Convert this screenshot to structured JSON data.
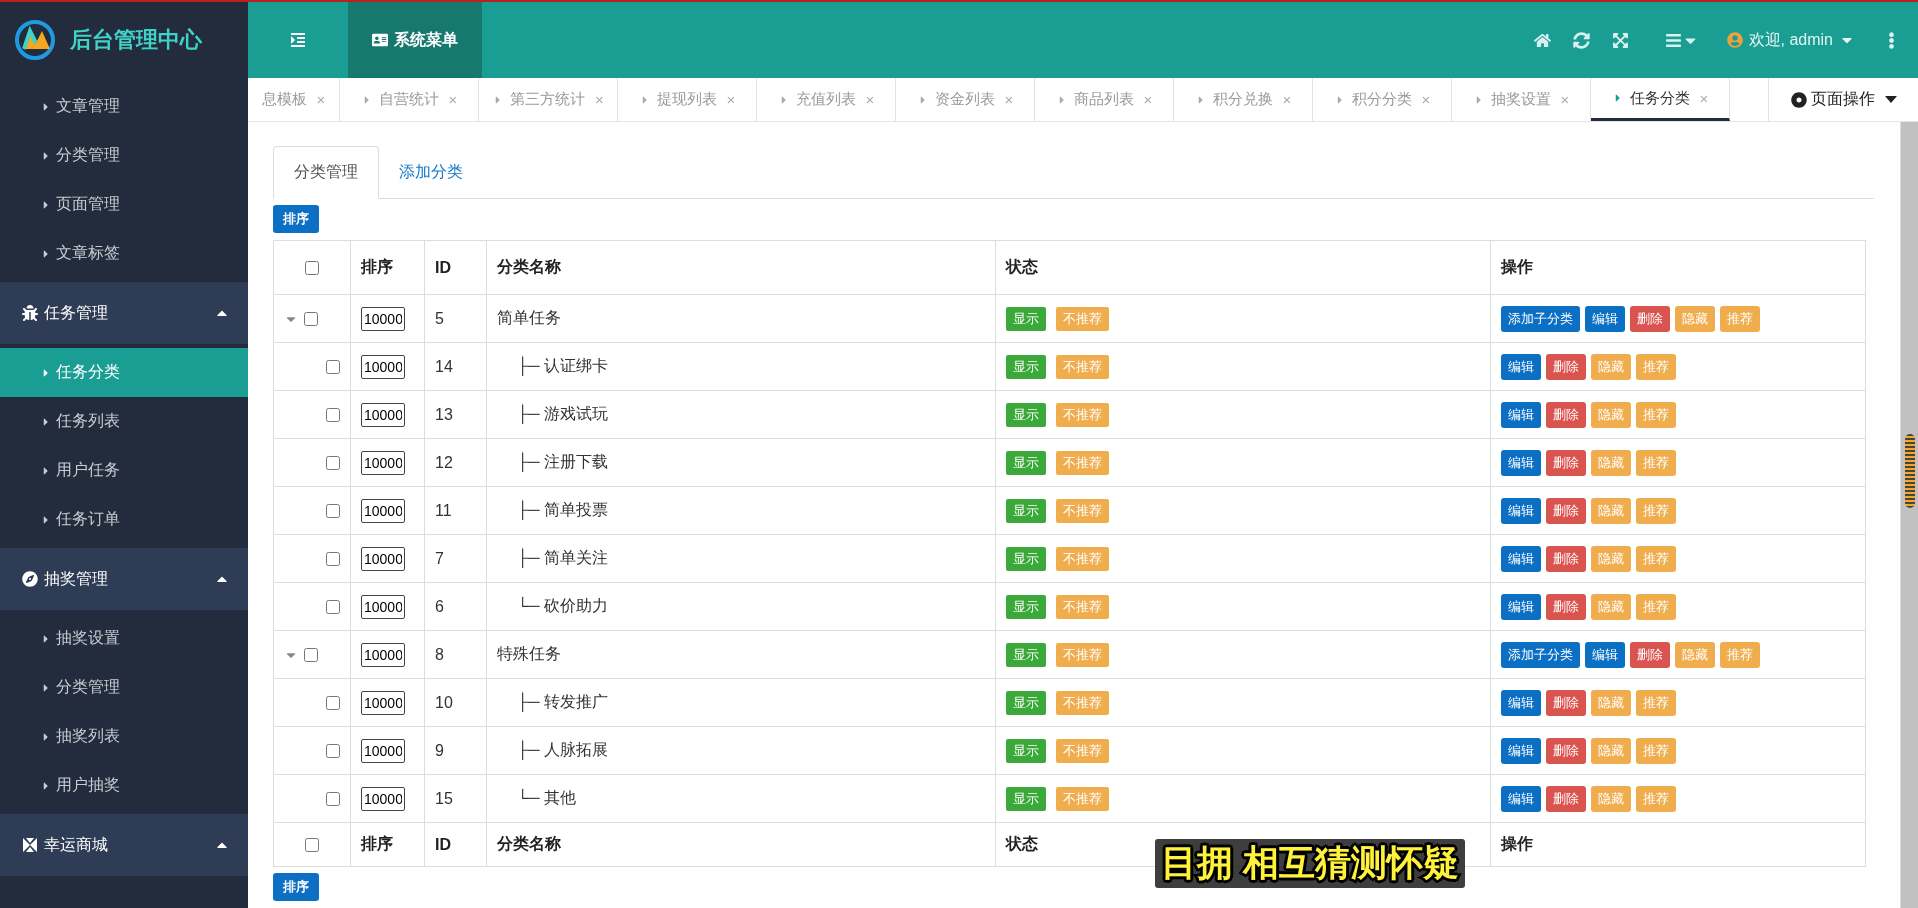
{
  "brand": {
    "title": "后台管理中心"
  },
  "header": {
    "menu_button": "系统菜单",
    "user": "欢迎, admin"
  },
  "sidebar": {
    "items": [
      {
        "kind": "link",
        "label": "文章管理",
        "selected": false
      },
      {
        "kind": "link",
        "label": "分类管理",
        "selected": false
      },
      {
        "kind": "link",
        "label": "页面管理",
        "selected": false
      },
      {
        "kind": "link",
        "label": "文章标签",
        "selected": false
      },
      {
        "kind": "group",
        "label": "任务管理",
        "expanded": true
      },
      {
        "kind": "link",
        "label": "任务分类",
        "selected": true
      },
      {
        "kind": "link",
        "label": "任务列表",
        "selected": false
      },
      {
        "kind": "link",
        "label": "用户任务",
        "selected": false
      },
      {
        "kind": "link",
        "label": "任务订单",
        "selected": false
      },
      {
        "kind": "group",
        "label": "抽奖管理",
        "expanded": true
      },
      {
        "kind": "link",
        "label": "抽奖设置",
        "selected": false
      },
      {
        "kind": "link",
        "label": "分类管理",
        "selected": false
      },
      {
        "kind": "link",
        "label": "抽奖列表",
        "selected": false
      },
      {
        "kind": "link",
        "label": "用户抽奖",
        "selected": false
      },
      {
        "kind": "group",
        "label": "幸运商城",
        "expanded": true
      }
    ]
  },
  "page_tabs": {
    "items": [
      {
        "label": "息模板",
        "close": "×",
        "selected": false
      },
      {
        "label": "自营统计",
        "close": "×",
        "selected": false
      },
      {
        "label": "第三方统计",
        "close": "×",
        "selected": false
      },
      {
        "label": "提现列表",
        "close": "×",
        "selected": false
      },
      {
        "label": "充值列表",
        "close": "×",
        "selected": false
      },
      {
        "label": "资金列表",
        "close": "×",
        "selected": false
      },
      {
        "label": "商品列表",
        "close": "×",
        "selected": false
      },
      {
        "label": "积分兑换",
        "close": "×",
        "selected": false
      },
      {
        "label": "积分分类",
        "close": "×",
        "selected": false
      },
      {
        "label": "抽奖设置",
        "close": "×",
        "selected": false
      },
      {
        "label": "任务分类",
        "close": "×",
        "selected": true
      }
    ],
    "page_actions": "页面操作"
  },
  "content_tabs": [
    {
      "label": "分类管理",
      "selected": true
    },
    {
      "label": "添加分类",
      "selected": false
    }
  ],
  "sort_button": "排序",
  "table": {
    "columns": [
      "排序",
      "ID",
      "分类名称",
      "状态",
      "操作"
    ],
    "rows": [
      {
        "sort": "10000",
        "id": "5",
        "name": "简单任务",
        "checked": false,
        "expanded": true,
        "status": [
          {
            "label": "显示",
            "kind": "success"
          },
          {
            "label": "不推荐",
            "kind": "warning"
          }
        ],
        "actions": [
          {
            "label": "添加子分类",
            "kind": "primary"
          },
          {
            "label": "编辑",
            "kind": "primary"
          },
          {
            "label": "删除",
            "kind": "danger"
          },
          {
            "label": "隐藏",
            "kind": "warning"
          },
          {
            "label": "推荐",
            "kind": "warning"
          }
        ],
        "children": [
          {
            "sort": "10000",
            "id": "14",
            "name": "├─ 认证绑卡",
            "checked": false,
            "status": [
              {
                "label": "显示",
                "kind": "success"
              },
              {
                "label": "不推荐",
                "kind": "warning"
              }
            ],
            "actions": [
              {
                "label": "编辑",
                "kind": "primary"
              },
              {
                "label": "删除",
                "kind": "danger"
              },
              {
                "label": "隐藏",
                "kind": "warning"
              },
              {
                "label": "推荐",
                "kind": "warning"
              }
            ]
          },
          {
            "sort": "10000",
            "id": "13",
            "name": "├─ 游戏试玩",
            "checked": false,
            "status": [
              {
                "label": "显示",
                "kind": "success"
              },
              {
                "label": "不推荐",
                "kind": "warning"
              }
            ],
            "actions": [
              {
                "label": "编辑",
                "kind": "primary"
              },
              {
                "label": "删除",
                "kind": "danger"
              },
              {
                "label": "隐藏",
                "kind": "warning"
              },
              {
                "label": "推荐",
                "kind": "warning"
              }
            ]
          },
          {
            "sort": "10000",
            "id": "12",
            "name": "├─ 注册下载",
            "checked": false,
            "status": [
              {
                "label": "显示",
                "kind": "success"
              },
              {
                "label": "不推荐",
                "kind": "warning"
              }
            ],
            "actions": [
              {
                "label": "编辑",
                "kind": "primary"
              },
              {
                "label": "删除",
                "kind": "danger"
              },
              {
                "label": "隐藏",
                "kind": "warning"
              },
              {
                "label": "推荐",
                "kind": "warning"
              }
            ]
          },
          {
            "sort": "10000",
            "id": "11",
            "name": "├─ 简单投票",
            "checked": false,
            "status": [
              {
                "label": "显示",
                "kind": "success"
              },
              {
                "label": "不推荐",
                "kind": "warning"
              }
            ],
            "actions": [
              {
                "label": "编辑",
                "kind": "primary"
              },
              {
                "label": "删除",
                "kind": "danger"
              },
              {
                "label": "隐藏",
                "kind": "warning"
              },
              {
                "label": "推荐",
                "kind": "warning"
              }
            ]
          },
          {
            "sort": "10000",
            "id": "7",
            "name": "├─ 简单关注",
            "checked": false,
            "status": [
              {
                "label": "显示",
                "kind": "success"
              },
              {
                "label": "不推荐",
                "kind": "warning"
              }
            ],
            "actions": [
              {
                "label": "编辑",
                "kind": "primary"
              },
              {
                "label": "删除",
                "kind": "danger"
              },
              {
                "label": "隐藏",
                "kind": "warning"
              },
              {
                "label": "推荐",
                "kind": "warning"
              }
            ]
          },
          {
            "sort": "10000",
            "id": "6",
            "name": "└─ 砍价助力",
            "checked": false,
            "status": [
              {
                "label": "显示",
                "kind": "success"
              },
              {
                "label": "不推荐",
                "kind": "warning"
              }
            ],
            "actions": [
              {
                "label": "编辑",
                "kind": "primary"
              },
              {
                "label": "删除",
                "kind": "danger"
              },
              {
                "label": "隐藏",
                "kind": "warning"
              },
              {
                "label": "推荐",
                "kind": "warning"
              }
            ]
          }
        ]
      },
      {
        "sort": "10000",
        "id": "8",
        "name": "特殊任务",
        "checked": false,
        "expanded": true,
        "status": [
          {
            "label": "显示",
            "kind": "success"
          },
          {
            "label": "不推荐",
            "kind": "warning"
          }
        ],
        "actions": [
          {
            "label": "添加子分类",
            "kind": "primary"
          },
          {
            "label": "编辑",
            "kind": "primary"
          },
          {
            "label": "删除",
            "kind": "danger"
          },
          {
            "label": "隐藏",
            "kind": "warning"
          },
          {
            "label": "推荐",
            "kind": "warning"
          }
        ],
        "children": [
          {
            "sort": "10000",
            "id": "10",
            "name": "├─ 转发推广",
            "checked": false,
            "status": [
              {
                "label": "显示",
                "kind": "success"
              },
              {
                "label": "不推荐",
                "kind": "warning"
              }
            ],
            "actions": [
              {
                "label": "编辑",
                "kind": "primary"
              },
              {
                "label": "删除",
                "kind": "danger"
              },
              {
                "label": "隐藏",
                "kind": "warning"
              },
              {
                "label": "推荐",
                "kind": "warning"
              }
            ]
          },
          {
            "sort": "10000",
            "id": "9",
            "name": "├─ 人脉拓展",
            "checked": false,
            "status": [
              {
                "label": "显示",
                "kind": "success"
              },
              {
                "label": "不推荐",
                "kind": "warning"
              }
            ],
            "actions": [
              {
                "label": "编辑",
                "kind": "primary"
              },
              {
                "label": "删除",
                "kind": "danger"
              },
              {
                "label": "隐藏",
                "kind": "warning"
              },
              {
                "label": "推荐",
                "kind": "warning"
              }
            ]
          },
          {
            "sort": "10000",
            "id": "15",
            "name": "└─ 其他",
            "checked": false,
            "status": [
              {
                "label": "显示",
                "kind": "success"
              },
              {
                "label": "不推荐",
                "kind": "warning"
              }
            ],
            "actions": [
              {
                "label": "编辑",
                "kind": "primary"
              },
              {
                "label": "删除",
                "kind": "danger"
              },
              {
                "label": "隐藏",
                "kind": "warning"
              },
              {
                "label": "推荐",
                "kind": "warning"
              }
            ]
          }
        ]
      }
    ],
    "footer_columns": [
      "排序",
      "ID",
      "分类名称",
      "状态",
      "操作"
    ],
    "header_checked": false,
    "footer_checked": false
  },
  "bottom_sort_button": "排序",
  "overlay_text": "目拥 相互猜测怀疑"
}
